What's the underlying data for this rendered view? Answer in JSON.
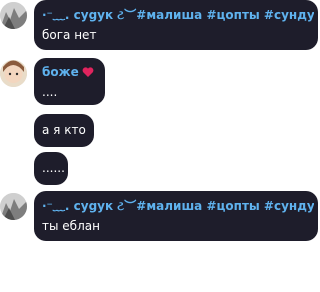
{
  "colors": {
    "bubble_bg": "#1e1d2b",
    "text": "#ffffff",
    "sender_name": "#5fb2ee",
    "heart": "#e0245e"
  },
  "messages": [
    {
      "sender": "·⁻﹏. cуgук ટ︶#малиша #цопты #сундук",
      "text": "бога нет",
      "avatar": "grey-photo"
    },
    {
      "sender": "боже",
      "sender_icon": "heart-icon",
      "text": "....",
      "avatar": "cartoon-photo"
    },
    {
      "sender": "",
      "text": "а я кто"
    },
    {
      "sender": "",
      "text": "......"
    },
    {
      "sender": "·⁻﹏. cуgук ટ︶#малиша #цопты #сундук",
      "text": "ты еблан",
      "avatar": "grey-photo"
    }
  ]
}
